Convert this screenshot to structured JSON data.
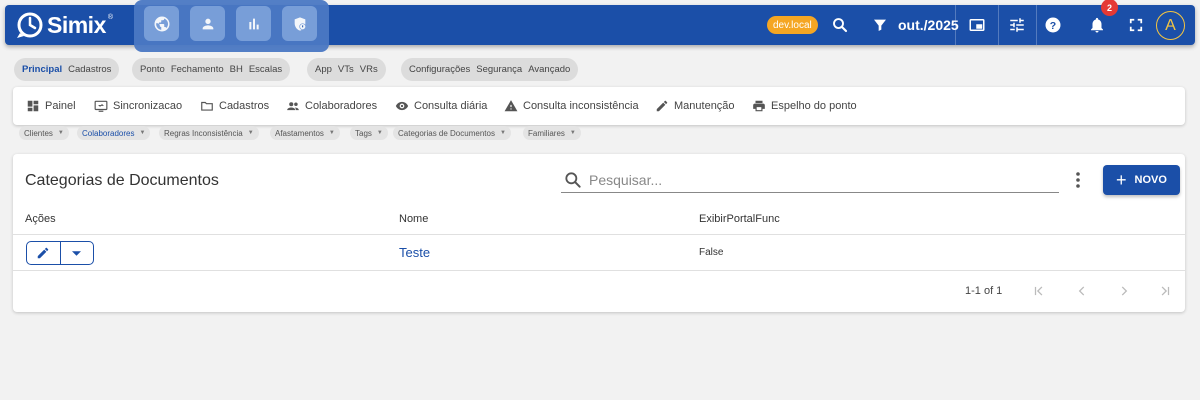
{
  "app": {
    "name": "Simix",
    "reg": "®"
  },
  "header": {
    "env_badge": "dev.local",
    "period": "out./2025",
    "notification_count": "2",
    "avatar_initial": "A"
  },
  "module_buttons": [
    "globe-icon",
    "person-icon",
    "bar-chart-icon",
    "shield-icon"
  ],
  "sections": [
    {
      "items": [
        "Principal",
        "Cadastros"
      ],
      "active": "Principal"
    },
    {
      "items": [
        "Ponto",
        "Fechamento",
        "BH",
        "Escalas"
      ]
    },
    {
      "items": [
        "App",
        "VTs",
        "VRs"
      ]
    },
    {
      "items": [
        "Configurações",
        "Segurança",
        "Avançado"
      ]
    }
  ],
  "nav": {
    "painel": "Painel",
    "sincronizacao": "Sincronizacao",
    "cadastros": "Cadastros",
    "colaboradores": "Colaboradores",
    "consulta_diaria": "Consulta diária",
    "consulta_inconsistencia": "Consulta inconsistência",
    "manutencao": "Manutenção",
    "espelho": "Espelho do ponto"
  },
  "subtabs": {
    "clientes": "Clientes",
    "colaboradores": "Colaboradores",
    "regras": "Regras Inconsistência",
    "afastamentos": "Afastamentos",
    "tags": "Tags",
    "categorias": "Categorias de Documentos",
    "familiares": "Familiares",
    "active": "Colaboradores"
  },
  "page": {
    "title": "Categorias de Documentos",
    "search_placeholder": "Pesquisar...",
    "new_button": "NOVO"
  },
  "table": {
    "columns": {
      "acoes": "Ações",
      "nome": "Nome",
      "exibir": "ExibirPortalFunc"
    },
    "rows": [
      {
        "nome": "Teste",
        "exibir": "False"
      }
    ]
  },
  "pagination": {
    "range": "1-1 of 1"
  },
  "colors": {
    "primary": "#1b4fa8",
    "accent": "#f5a623",
    "alert": "#e53935",
    "avatar": "#f4c542"
  }
}
